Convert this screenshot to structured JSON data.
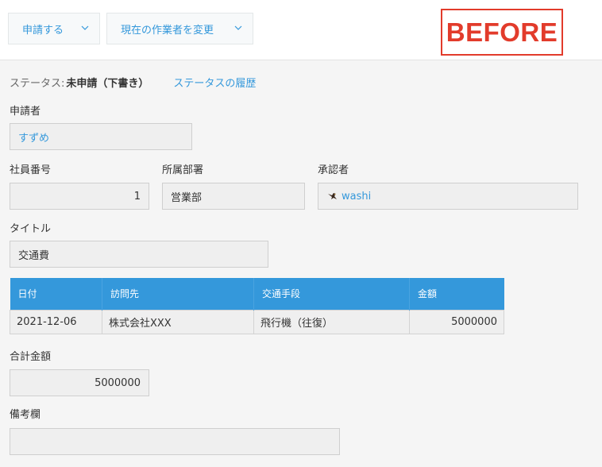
{
  "toolbar": {
    "apply_label": "申請する",
    "change_assignee_label": "現在の作業者を変更"
  },
  "stamp": {
    "text": "BEFORE",
    "color": "#e23b2b"
  },
  "status": {
    "label": "ステータス:",
    "value": "未申請（下書き）",
    "history_link": "ステータスの履歴"
  },
  "fields": {
    "applicant": {
      "label": "申請者",
      "value": "すずめ"
    },
    "employee_no": {
      "label": "社員番号",
      "value": "1"
    },
    "department": {
      "label": "所属部署",
      "value": "営業部"
    },
    "approver": {
      "label": "承認者",
      "value": "washi",
      "icon": "bird-icon"
    },
    "title": {
      "label": "タイトル",
      "value": "交通費"
    },
    "total": {
      "label": "合計金額",
      "value": "5000000"
    },
    "remarks": {
      "label": "備考欄",
      "value": ""
    }
  },
  "table": {
    "headers": [
      "日付",
      "訪問先",
      "交通手段",
      "金額"
    ],
    "rows": [
      [
        "2021-12-06",
        "株式会社XXX",
        "飛行機（往復）",
        "5000000"
      ]
    ]
  },
  "colors": {
    "accent": "#3498db",
    "field_bg": "#efefef",
    "page_bg": "#f5f5f5"
  }
}
